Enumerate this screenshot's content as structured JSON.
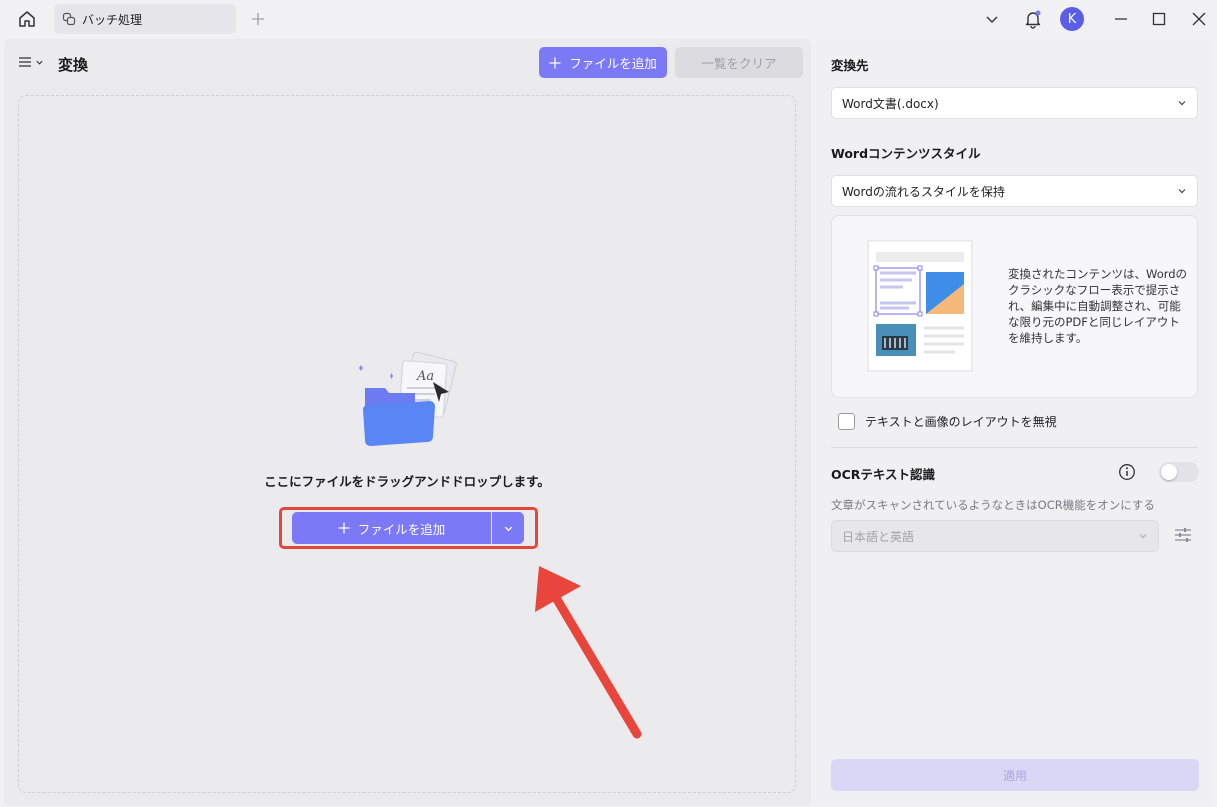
{
  "titlebar": {
    "tab_label": "バッチ処理",
    "avatar_letter": "K"
  },
  "left": {
    "title": "変換",
    "add_file_label": "ファイルを追加",
    "clear_list_label": "一覧をクリア",
    "drop_text": "ここにファイルをドラッグアンドドロップします。",
    "add_file_main_label": "ファイルを追加"
  },
  "right": {
    "convert_to_label": "変換先",
    "convert_to_value": "Word文書(.docx)",
    "content_style_label": "Wordコンテンツスタイル",
    "content_style_value": "Wordの流れるスタイルを保持",
    "preview_description": "変換されたコンテンツは、Wordのクラシックなフロー表示で提示され、編集中に自動調整され、可能な限り元のPDFと同じレイアウトを維持します。",
    "ignore_layout_label": "テキストと画像のレイアウトを無視",
    "ocr_label": "OCRテキスト認識",
    "ocr_hint": "文章がスキャンされているようなときはOCR機能をオンにする",
    "ocr_language_value": "日本語と英語",
    "apply_label": "適用"
  },
  "state": {
    "ignore_layout_checked": false,
    "ocr_enabled": false
  },
  "colors": {
    "accent": "#7b79f6",
    "highlight": "#e8453c"
  }
}
